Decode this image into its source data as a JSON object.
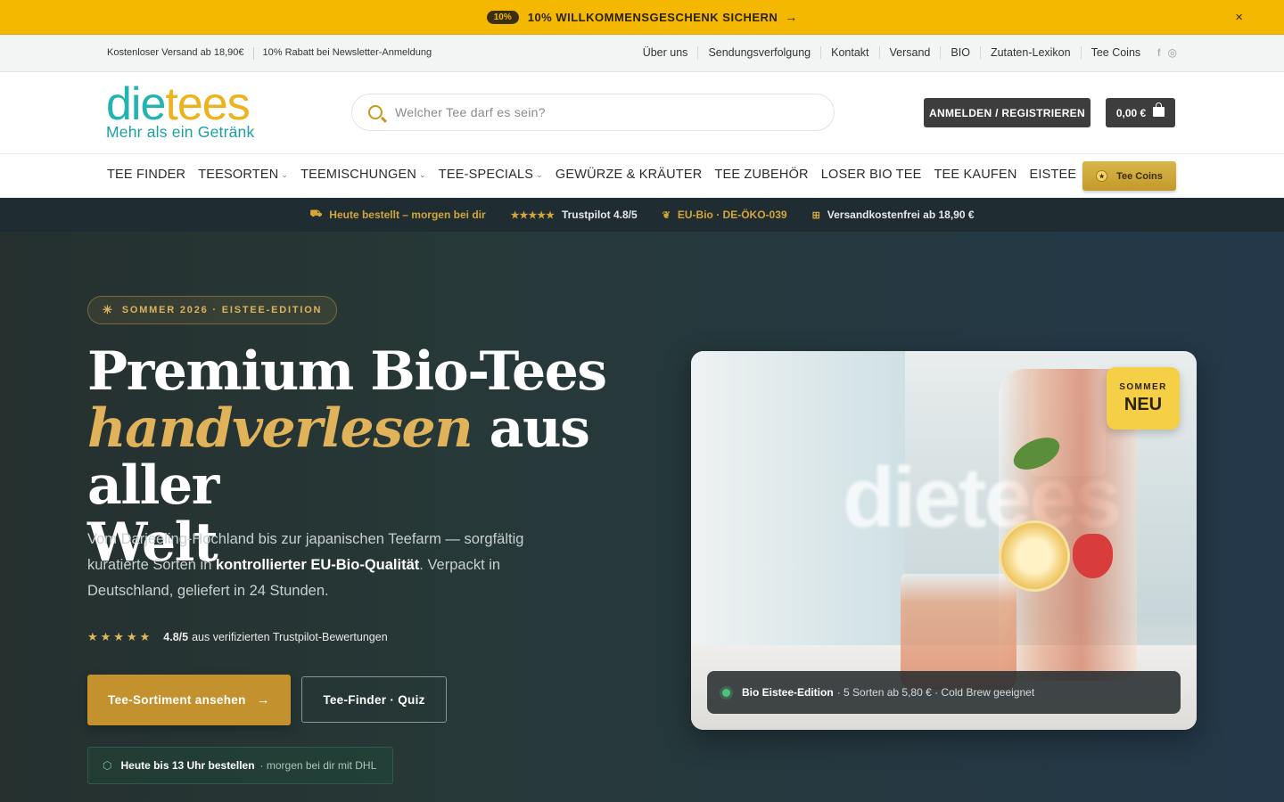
{
  "promo": {
    "pill": "10%",
    "text": "10% WILLKOMMENSGESCHENK SICHERN",
    "arrow": "→",
    "close": "×"
  },
  "util": {
    "left": [
      "Kostenloser Versand ab 18,90€",
      "10% Rabatt bei Newsletter-Anmeldung"
    ],
    "links": [
      "Über uns",
      "Sendungsverfolgung",
      "Kontakt",
      "Versand",
      "BIO",
      "Zutaten-Lexikon",
      "Tee Coins"
    ],
    "social": {
      "facebook": "f",
      "instagram": "◎"
    }
  },
  "logo": {
    "word_a": "die",
    "word_b": "tees",
    "tagline": "Mehr als ein Getränk"
  },
  "search": {
    "placeholder": "Welcher Tee darf es sein?"
  },
  "header": {
    "login": "ANMELDEN / REGISTRIEREN",
    "cart": "0,00 €"
  },
  "nav": {
    "items": [
      {
        "label": "TEE FINDER",
        "dropdown": false
      },
      {
        "label": "TEESORTEN",
        "dropdown": true
      },
      {
        "label": "TEEMISCHUNGEN",
        "dropdown": true
      },
      {
        "label": "TEE-SPECIALS",
        "dropdown": true
      },
      {
        "label": "GEWÜRZE & KRÄUTER",
        "dropdown": false
      },
      {
        "label": "TEE ZUBEHÖR",
        "dropdown": false
      },
      {
        "label": "LOSER BIO TEE",
        "dropdown": false
      },
      {
        "label": "TEE KAUFEN",
        "dropdown": false
      },
      {
        "label": "EISTEE",
        "dropdown": false
      }
    ],
    "coins": "Tee Coins"
  },
  "trust": {
    "delivery": "Heute bestellt – morgen bei dir",
    "stars": "★★★★★",
    "trustpilot": "Trustpilot 4.8/5",
    "bio": "EU-Bio · DE-ÖKO-039",
    "shipping": "Versandkostenfrei ab 18,90 €"
  },
  "hero": {
    "badge": "SOMMER 2026 · EISTEE-EDITION",
    "title_1": "Premium Bio-Tees",
    "title_italic": "handverlesen",
    "title_2": " aus aller",
    "title_3": "Welt",
    "lead_1": "Vom Darjeeling-Hochland bis zur japanischen Teefarm — sorgfältig kuratierte Sorten in ",
    "lead_bold": "kontrollierter EU-Bio-Qualität",
    "lead_2": ". Verpackt in Deutschland, geliefert in 24 Stunden.",
    "rating_stars": "★★★★★",
    "rating_score": "4.8/5",
    "rating_text": "aus verifizierten Trustpilot-Bewertungen",
    "cta_primary": "Tee-Sortiment ansehen",
    "cta_secondary": "Tee-Finder · Quiz",
    "ship_bold": "Heute bis 13 Uhr bestellen",
    "ship_text": "· morgen bei dir mit DHL"
  },
  "card": {
    "badge_small": "SOMMER",
    "badge_big": "NEU",
    "caption_bold": "Bio Eistee-Edition",
    "caption_text": "· 5 Sorten ab 5,80 € · Cold Brew geeignet"
  }
}
